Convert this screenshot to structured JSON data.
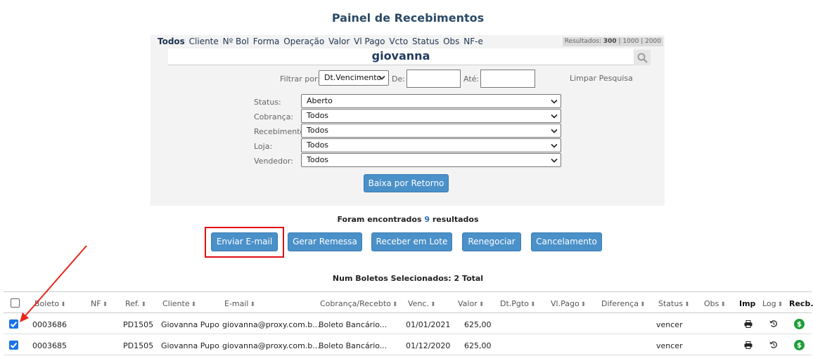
{
  "page_title": "Painel de Recebimentos",
  "filter_tabs": [
    "Todos",
    "Cliente",
    "Nº Bol",
    "Forma",
    "Operação",
    "Valor",
    "Vl Pago",
    "Vcto",
    "Status",
    "Obs",
    "NF-e"
  ],
  "results_pager": {
    "label": "Resultados:",
    "options": [
      "300",
      "1000",
      "2000"
    ],
    "selected": "300"
  },
  "search": {
    "value": "giovanna"
  },
  "date_filter": {
    "label": "Filtrar por:",
    "selected": "Dt.Vencimento",
    "from_label": "De:",
    "to_label": "Até:",
    "from_value": "",
    "to_value": ""
  },
  "clear_search": "Limpar Pesquisa",
  "filters": {
    "status": {
      "label": "Status:",
      "value": "Aberto"
    },
    "cobranca": {
      "label": "Cobrança:",
      "value": "Todos"
    },
    "recebimento": {
      "label": "Recebimento:",
      "value": "Todos"
    },
    "loja": {
      "label": "Loja:",
      "value": "Todos"
    },
    "vendedor": {
      "label": "Vendedor:",
      "value": "Todos"
    }
  },
  "baixa_button": "Baixa por Retorno",
  "results": {
    "prefix": "Foram encontrados",
    "count": "9",
    "suffix": "resultados"
  },
  "actions": {
    "enviar_email": "Enviar E-mail",
    "gerar_remessa": "Gerar Remessa",
    "receber_lote": "Receber em Lote",
    "renegociar": "Renegociar",
    "cancelamento": "Cancelamento"
  },
  "selected_text": "Num Boletos Selecionados: 2 Total",
  "columns": {
    "boleto": "Boleto",
    "nf": "NF",
    "ref": "Ref.",
    "cliente": "Cliente",
    "email": "E-mail",
    "cobranca": "Cobrança/Recebto",
    "venc": "Venc.",
    "valor": "Valor",
    "dtpgto": "Dt.Pgto",
    "vlpago": "Vl.Pago",
    "diferenca": "Diferença",
    "status": "Status",
    "obs": "Obs",
    "imp": "Imp",
    "log": "Log",
    "recb": "Recb."
  },
  "rows": [
    {
      "checked": true,
      "boleto": "0003686",
      "nf": "",
      "ref": "PD1505",
      "cliente": "Giovanna Pupo",
      "email": "giovanna@proxy.com.b...",
      "cobranca": "Boleto Bancário...",
      "venc": "01/01/2021",
      "valor": "625,00",
      "status": "vencer"
    },
    {
      "checked": true,
      "boleto": "0003685",
      "nf": "",
      "ref": "PD1505",
      "cliente": "Giovanna Pupo",
      "email": "giovanna@proxy.com.b...",
      "cobranca": "Boleto Bancário...",
      "venc": "01/12/2020",
      "valor": "625,00",
      "status": "vencer"
    }
  ],
  "colors": {
    "accent_button": "#4a90c9",
    "title": "#2a4a66",
    "highlight": "#e01010",
    "money_icon": "#1e9e3a",
    "checkbox": "#1a73e8"
  }
}
